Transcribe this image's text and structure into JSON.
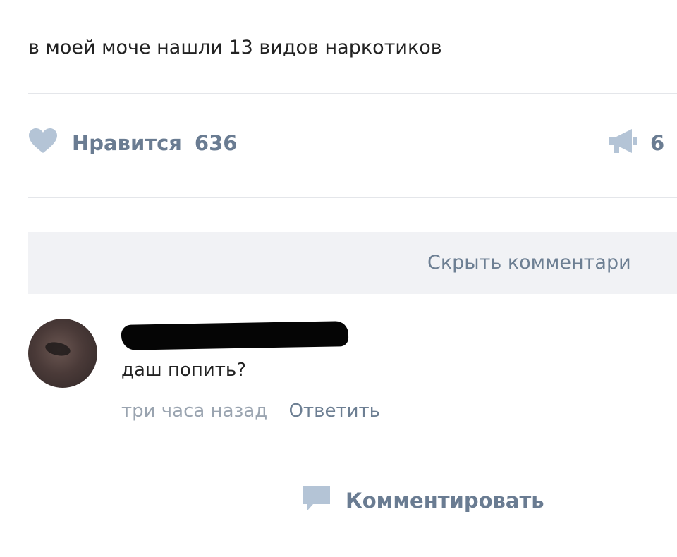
{
  "post": {
    "text": "в моей моче нашли 13 видов наркотиков"
  },
  "actions": {
    "like_label": "Нравится",
    "like_count": "636",
    "comment_label": "Комментировать",
    "share_count": "6"
  },
  "comments_bar": {
    "hide_label": "Скрыть комментари"
  },
  "comment": {
    "text": "даш попить?",
    "time": "три часа назад",
    "reply_label": "Ответить"
  },
  "icons": {
    "like": "heart-icon",
    "comment": "speech-bubble-icon",
    "share": "megaphone-icon"
  },
  "colors": {
    "action_text": "#6a7c92",
    "icon": "#b4c4d6",
    "bar_background": "#f1f2f5"
  }
}
